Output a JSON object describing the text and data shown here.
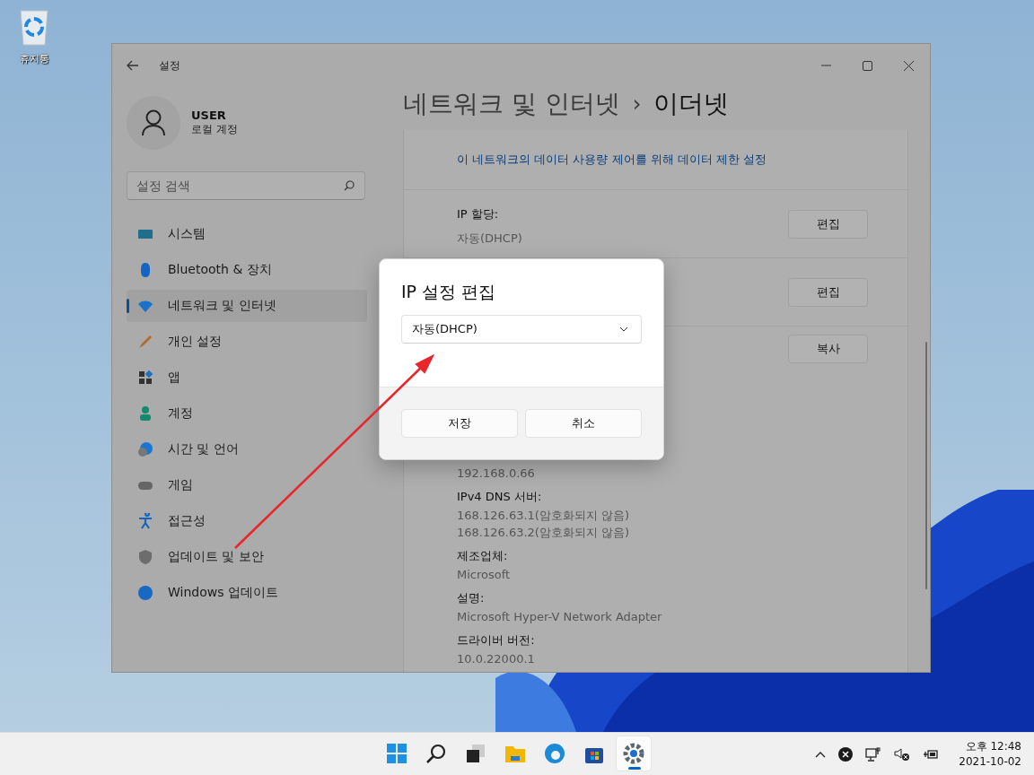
{
  "desktop_icons": [
    {
      "label": "휴지통"
    }
  ],
  "window": {
    "title": "설정",
    "user": {
      "name": "USER",
      "account": "로컬 계정"
    },
    "search": {
      "placeholder": "설정 검색"
    },
    "nav": [
      {
        "label": "시스템",
        "selected": false
      },
      {
        "label": "Bluetooth & 장치",
        "selected": false
      },
      {
        "label": "네트워크 및 인터넷",
        "selected": true
      },
      {
        "label": "개인 설정",
        "selected": false
      },
      {
        "label": "앱",
        "selected": false
      },
      {
        "label": "계정",
        "selected": false
      },
      {
        "label": "시간 및 언어",
        "selected": false
      },
      {
        "label": "게임",
        "selected": false
      },
      {
        "label": "접근성",
        "selected": false
      },
      {
        "label": "업데이트 및 보안",
        "selected": false
      },
      {
        "label": "Windows 업데이트",
        "selected": false
      }
    ],
    "breadcrumb": {
      "parent": "네트워크 및 인터넷",
      "separator": "›",
      "current": "이더넷"
    },
    "link": "이 네트워크의 데이터 사용량 제어를 위해 데이터 제한 설정",
    "rows": [
      {
        "label": "IP 할당:",
        "value": "자동(DHCP)",
        "button": "편집"
      },
      {
        "button": "편집"
      },
      {
        "button": "복사"
      }
    ],
    "properties": [
      {
        "values": [
          "192.168.0.66"
        ]
      },
      {
        "label": "IPv4 DNS 서버:",
        "values": [
          "168.126.63.1(암호화되지 않음)",
          "168.126.63.2(암호화되지 않음)"
        ]
      },
      {
        "label": "제조업체:",
        "values": [
          "Microsoft"
        ]
      },
      {
        "label": "설명:",
        "values": [
          "Microsoft Hyper-V Network Adapter"
        ]
      },
      {
        "label": "드라이버 버전:",
        "values": [
          "10.0.22000.1"
        ]
      }
    ]
  },
  "dialog": {
    "title": "IP 설정 편집",
    "dropdown": {
      "value": "자동(DHCP)"
    },
    "buttons": [
      "저장",
      "취소"
    ]
  },
  "taskbar": {
    "apps": [
      {
        "selected": false
      },
      {
        "selected": false
      },
      {
        "selected": false
      },
      {
        "selected": false
      },
      {
        "selected": false
      },
      {
        "selected": false
      },
      {
        "selected": true
      }
    ],
    "time": "오후 12:48",
    "date": "2021-10-02"
  }
}
